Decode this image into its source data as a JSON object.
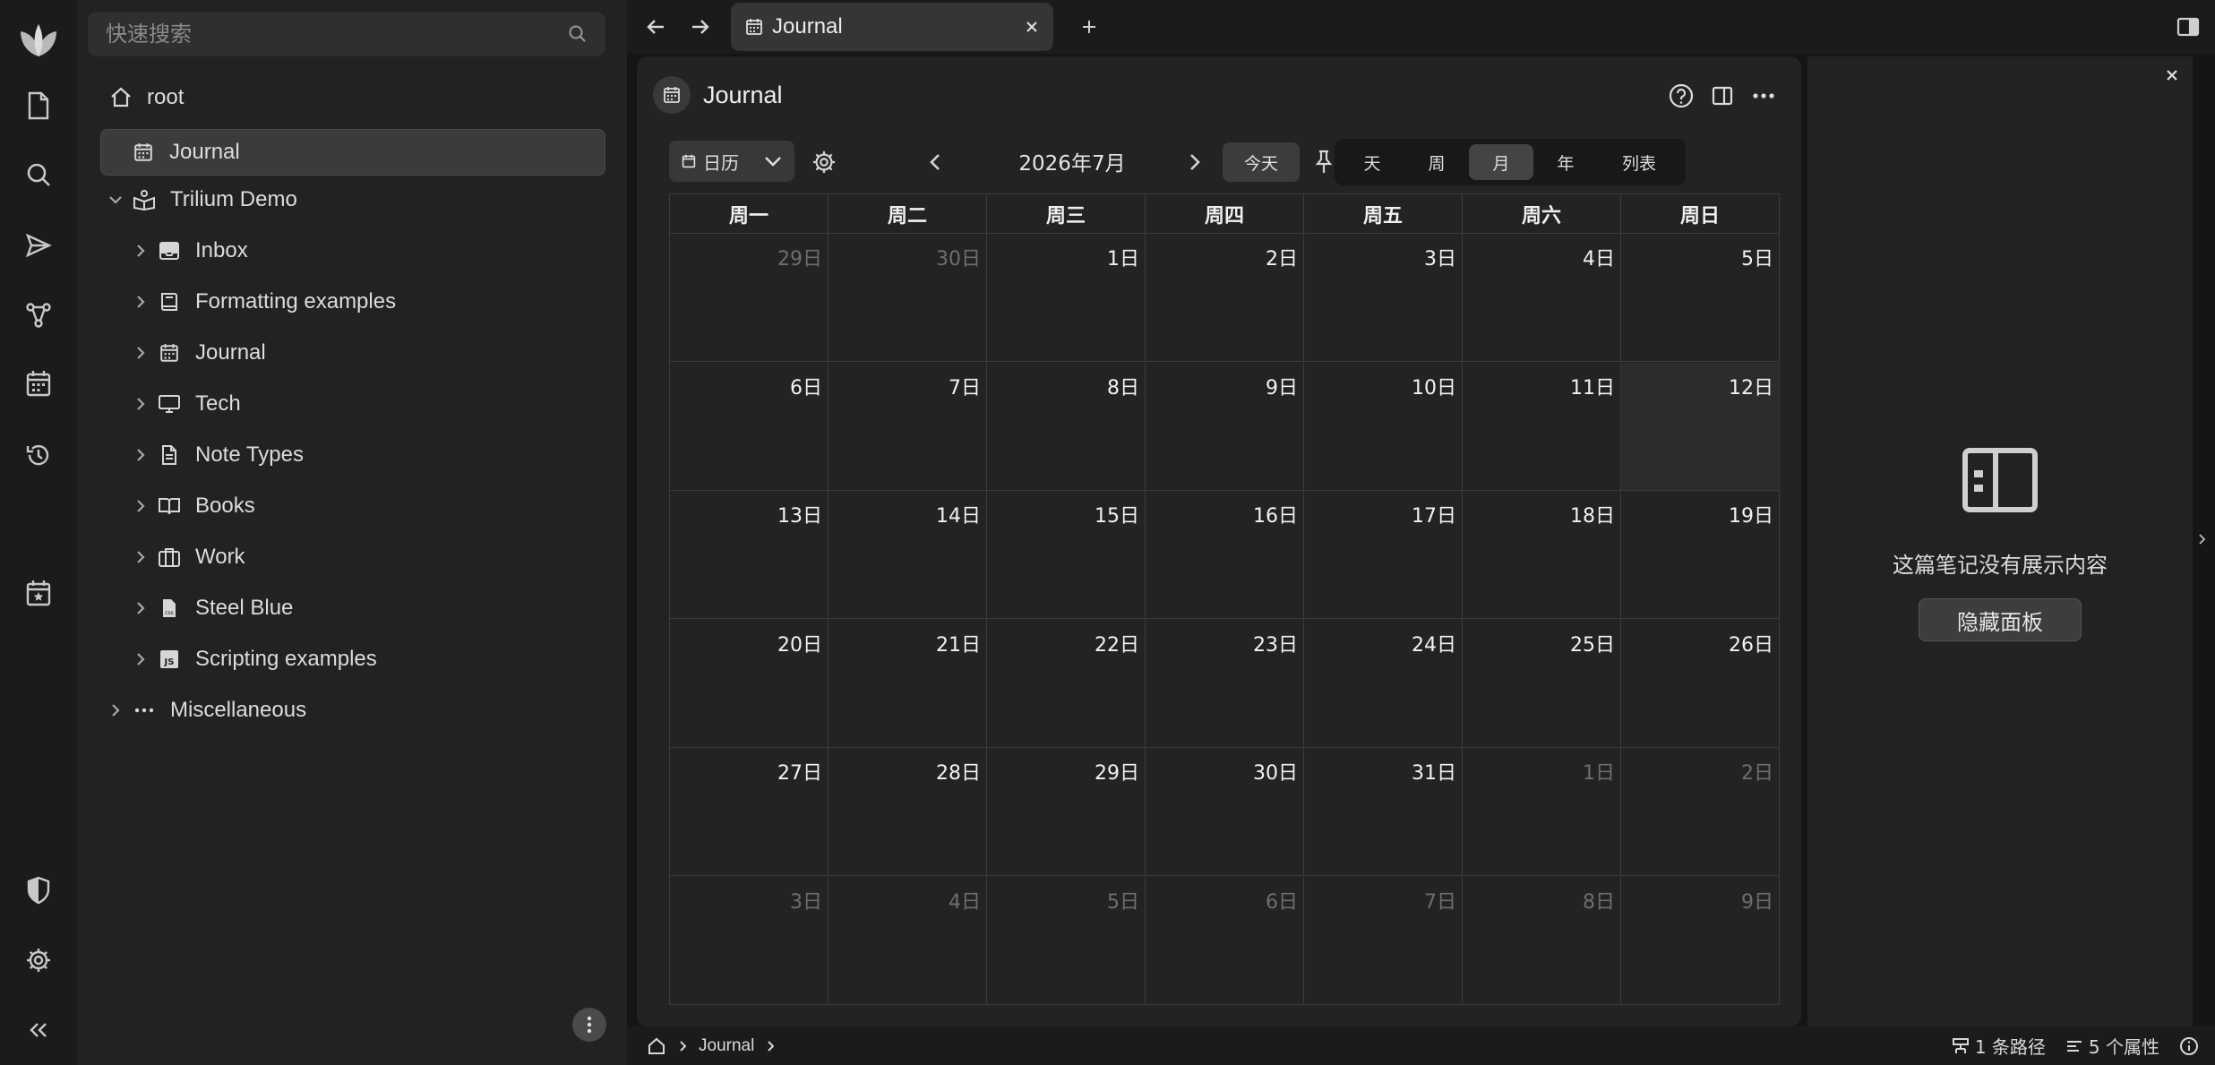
{
  "search": {
    "placeholder": "快速搜索"
  },
  "tree": [
    {
      "label": "root",
      "icon": "home-icon",
      "chevron": false,
      "indent": 0
    },
    {
      "label": "Journal",
      "icon": "calendar-icon",
      "chevron": false,
      "indent": 1,
      "active": true
    },
    {
      "label": "Trilium Demo",
      "icon": "book-reader-icon",
      "chevron": "down",
      "indent": 1
    },
    {
      "label": "Inbox",
      "icon": "inbox-icon",
      "chevron": "right",
      "indent": 2
    },
    {
      "label": "Formatting examples",
      "icon": "book-icon",
      "chevron": "right",
      "indent": 2
    },
    {
      "label": "Journal",
      "icon": "calendar-icon",
      "chevron": "right",
      "indent": 2
    },
    {
      "label": "Tech",
      "icon": "monitor-icon",
      "chevron": "right",
      "indent": 2
    },
    {
      "label": "Note Types",
      "icon": "file-icon",
      "chevron": "right",
      "indent": 2
    },
    {
      "label": "Books",
      "icon": "open-book-icon",
      "chevron": "right",
      "indent": 2
    },
    {
      "label": "Work",
      "icon": "briefcase-icon",
      "chevron": "right",
      "indent": 2
    },
    {
      "label": "Steel Blue",
      "icon": "css-file-icon",
      "chevron": "right",
      "indent": 2
    },
    {
      "label": "Scripting examples",
      "icon": "js-file-icon",
      "chevron": "right",
      "indent": 2
    },
    {
      "label": "Miscellaneous",
      "icon": "dots-icon",
      "chevron": "right",
      "indent": 1
    }
  ],
  "tab": {
    "title": "Journal"
  },
  "note": {
    "title": "Journal"
  },
  "calendar": {
    "view_select": "日历",
    "month_label": "2026年7月",
    "today_label": "今天",
    "views": [
      "天",
      "周",
      "月",
      "年",
      "列表"
    ],
    "active_view": "月",
    "weekdays": [
      "周一",
      "周二",
      "周三",
      "周四",
      "周五",
      "周六",
      "周日"
    ],
    "weeks": [
      [
        {
          "d": "29日",
          "o": true
        },
        {
          "d": "30日",
          "o": true
        },
        {
          "d": "1日"
        },
        {
          "d": "2日"
        },
        {
          "d": "3日"
        },
        {
          "d": "4日"
        },
        {
          "d": "5日"
        }
      ],
      [
        {
          "d": "6日"
        },
        {
          "d": "7日"
        },
        {
          "d": "8日"
        },
        {
          "d": "9日"
        },
        {
          "d": "10日"
        },
        {
          "d": "11日"
        },
        {
          "d": "12日",
          "today": true
        }
      ],
      [
        {
          "d": "13日"
        },
        {
          "d": "14日"
        },
        {
          "d": "15日"
        },
        {
          "d": "16日"
        },
        {
          "d": "17日"
        },
        {
          "d": "18日"
        },
        {
          "d": "19日"
        }
      ],
      [
        {
          "d": "20日"
        },
        {
          "d": "21日"
        },
        {
          "d": "22日"
        },
        {
          "d": "23日"
        },
        {
          "d": "24日"
        },
        {
          "d": "25日"
        },
        {
          "d": "26日"
        }
      ],
      [
        {
          "d": "27日"
        },
        {
          "d": "28日"
        },
        {
          "d": "29日"
        },
        {
          "d": "30日"
        },
        {
          "d": "31日"
        },
        {
          "d": "1日",
          "o": true
        },
        {
          "d": "2日",
          "o": true
        }
      ],
      [
        {
          "d": "3日",
          "o": true
        },
        {
          "d": "4日",
          "o": true
        },
        {
          "d": "5日",
          "o": true
        },
        {
          "d": "6日",
          "o": true
        },
        {
          "d": "7日",
          "o": true
        },
        {
          "d": "8日",
          "o": true
        },
        {
          "d": "9日",
          "o": true
        }
      ]
    ]
  },
  "right_panel": {
    "empty_text": "这篇笔记没有展示内容",
    "hide_button": "隐藏面板"
  },
  "status": {
    "breadcrumb": "Journal",
    "paths": "1 条路径",
    "attributes": "5 个属性"
  }
}
